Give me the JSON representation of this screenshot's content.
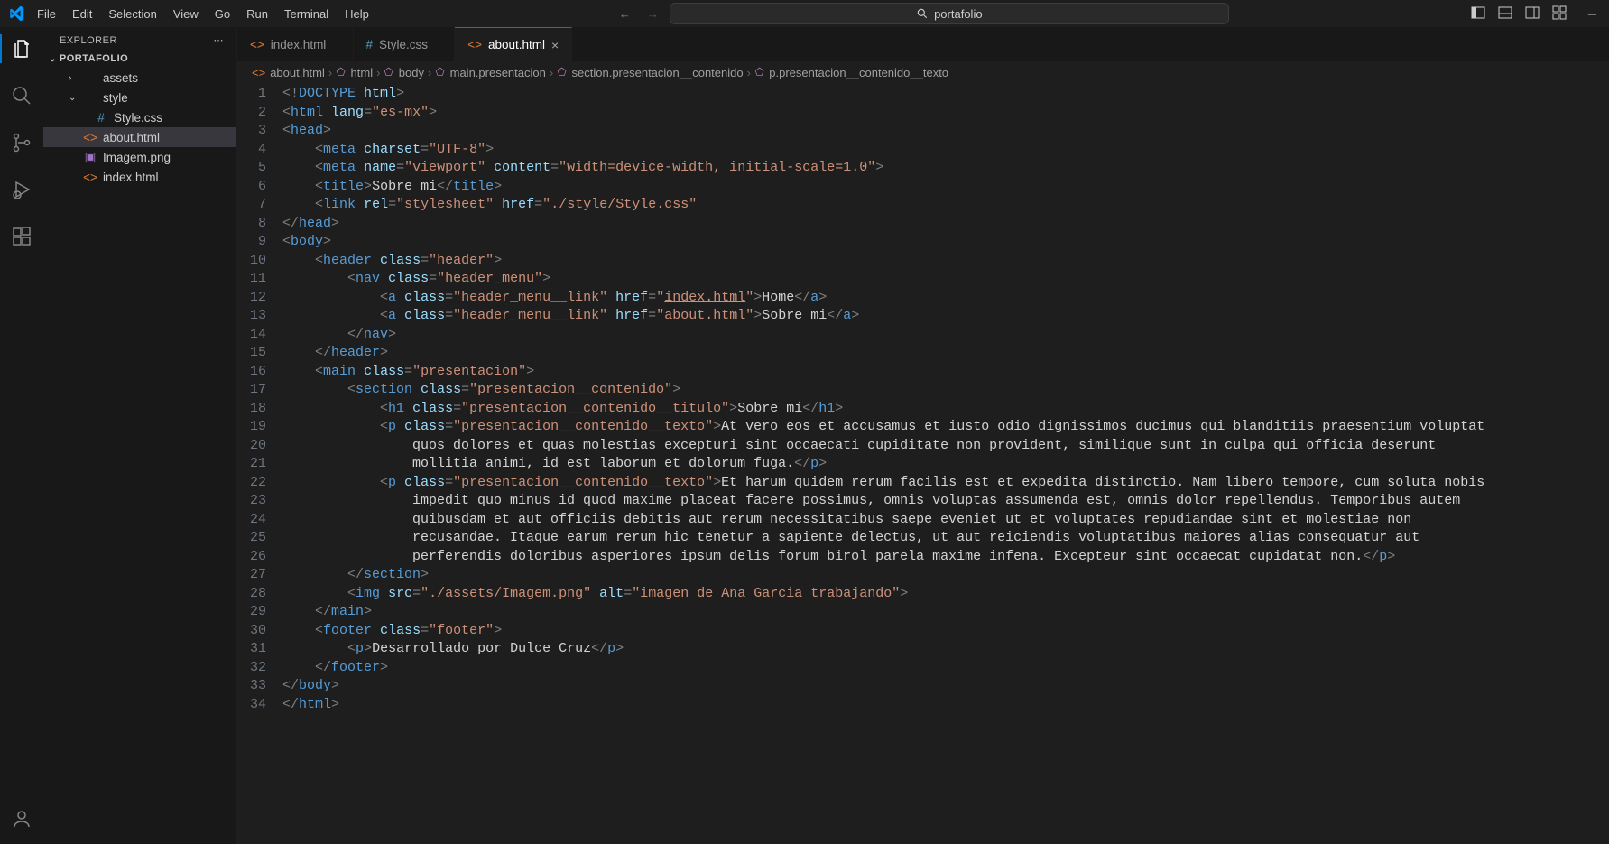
{
  "menubar": [
    "File",
    "Edit",
    "Selection",
    "View",
    "Go",
    "Run",
    "Terminal",
    "Help"
  ],
  "search": {
    "placeholder": "portafolio"
  },
  "sidebar": {
    "title": "EXPLORER",
    "project": "PORTAFOLIO",
    "tree": [
      {
        "type": "folder",
        "name": "assets",
        "expanded": false,
        "indent": 1
      },
      {
        "type": "folder",
        "name": "style",
        "expanded": true,
        "indent": 1
      },
      {
        "type": "file",
        "name": "Style.css",
        "icon": "css",
        "indent": 2
      },
      {
        "type": "file",
        "name": "about.html",
        "icon": "html",
        "indent": 1,
        "active": true
      },
      {
        "type": "file",
        "name": "Imagem.png",
        "icon": "img",
        "indent": 1
      },
      {
        "type": "file",
        "name": "index.html",
        "icon": "html",
        "indent": 1
      }
    ]
  },
  "tabs": [
    {
      "label": "index.html",
      "icon": "html",
      "active": false
    },
    {
      "label": "Style.css",
      "icon": "css",
      "active": false
    },
    {
      "label": "about.html",
      "icon": "html",
      "active": true
    }
  ],
  "breadcrumb": [
    {
      "icon": "file-html",
      "label": "about.html"
    },
    {
      "icon": "tag",
      "label": "html"
    },
    {
      "icon": "tag",
      "label": "body"
    },
    {
      "icon": "tag",
      "label": "main.presentacion"
    },
    {
      "icon": "tag",
      "label": "section.presentacion__contenido"
    },
    {
      "icon": "tag",
      "label": "p.presentacion__contenido__texto"
    }
  ],
  "code_lines": [
    {
      "n": 1,
      "html": "<span class='c-punct'>&lt;!</span><span class='c-doctype'>DOCTYPE</span> <span class='c-attr'>html</span><span class='c-punct'>&gt;</span>"
    },
    {
      "n": 2,
      "html": "<span class='c-punct'>&lt;</span><span class='c-tag'>html</span> <span class='c-attr'>lang</span><span class='c-punct'>=</span><span class='c-str'>\"es-mx\"</span><span class='c-punct'>&gt;</span>"
    },
    {
      "n": 3,
      "html": "<span class='c-punct'>&lt;</span><span class='c-tag'>head</span><span class='c-punct'>&gt;</span>"
    },
    {
      "n": 4,
      "html": "    <span class='c-punct'>&lt;</span><span class='c-tag'>meta</span> <span class='c-attr'>charset</span><span class='c-punct'>=</span><span class='c-str'>\"UTF-8\"</span><span class='c-punct'>&gt;</span>"
    },
    {
      "n": 5,
      "html": "    <span class='c-punct'>&lt;</span><span class='c-tag'>meta</span> <span class='c-attr'>name</span><span class='c-punct'>=</span><span class='c-str'>\"viewport\"</span> <span class='c-attr'>content</span><span class='c-punct'>=</span><span class='c-str'>\"width=device-width, initial-scale=1.0\"</span><span class='c-punct'>&gt;</span>"
    },
    {
      "n": 6,
      "html": "    <span class='c-punct'>&lt;</span><span class='c-tag'>title</span><span class='c-punct'>&gt;</span><span class='c-text'>Sobre mi</span><span class='c-punct'>&lt;/</span><span class='c-tag'>title</span><span class='c-punct'>&gt;</span>"
    },
    {
      "n": 7,
      "html": "    <span class='c-punct'>&lt;</span><span class='c-tag'>link</span> <span class='c-attr'>rel</span><span class='c-punct'>=</span><span class='c-str'>\"stylesheet\"</span> <span class='c-attr'>href</span><span class='c-punct'>=</span><span class='c-str'>\"</span><span class='c-str-u'>./style/Style.css</span><span class='c-str'>\"</span>"
    },
    {
      "n": 8,
      "html": "<span class='c-punct'>&lt;/</span><span class='c-tag'>head</span><span class='c-punct'>&gt;</span>"
    },
    {
      "n": 9,
      "html": "<span class='c-punct'>&lt;</span><span class='c-tag'>body</span><span class='c-punct'>&gt;</span>"
    },
    {
      "n": 10,
      "html": "    <span class='c-punct'>&lt;</span><span class='c-tag'>header</span> <span class='c-attr'>class</span><span class='c-punct'>=</span><span class='c-str'>\"header\"</span><span class='c-punct'>&gt;</span>"
    },
    {
      "n": 11,
      "html": "        <span class='c-punct'>&lt;</span><span class='c-tag'>nav</span> <span class='c-attr'>class</span><span class='c-punct'>=</span><span class='c-str'>\"header_menu\"</span><span class='c-punct'>&gt;</span>"
    },
    {
      "n": 12,
      "html": "            <span class='c-punct'>&lt;</span><span class='c-tag'>a</span> <span class='c-attr'>class</span><span class='c-punct'>=</span><span class='c-str'>\"header_menu__link\"</span> <span class='c-attr'>href</span><span class='c-punct'>=</span><span class='c-str'>\"</span><span class='c-str-u'>index.html</span><span class='c-str'>\"</span><span class='c-punct'>&gt;</span><span class='c-text'>Home</span><span class='c-punct'>&lt;/</span><span class='c-tag'>a</span><span class='c-punct'>&gt;</span>"
    },
    {
      "n": 13,
      "html": "            <span class='c-punct'>&lt;</span><span class='c-tag'>a</span> <span class='c-attr'>class</span><span class='c-punct'>=</span><span class='c-str'>\"header_menu__link\"</span> <span class='c-attr'>href</span><span class='c-punct'>=</span><span class='c-str'>\"</span><span class='c-str-u'>about.html</span><span class='c-str'>\"</span><span class='c-punct'>&gt;</span><span class='c-text'>Sobre mi</span><span class='c-punct'>&lt;/</span><span class='c-tag'>a</span><span class='c-punct'>&gt;</span>"
    },
    {
      "n": 14,
      "html": "        <span class='c-punct'>&lt;/</span><span class='c-tag'>nav</span><span class='c-punct'>&gt;</span>"
    },
    {
      "n": 15,
      "html": "    <span class='c-punct'>&lt;/</span><span class='c-tag'>header</span><span class='c-punct'>&gt;</span>"
    },
    {
      "n": 16,
      "html": "    <span class='c-punct'>&lt;</span><span class='c-tag'>main</span> <span class='c-attr'>class</span><span class='c-punct'>=</span><span class='c-str'>\"presentacion\"</span><span class='c-punct'>&gt;</span>"
    },
    {
      "n": 17,
      "html": "        <span class='c-punct'>&lt;</span><span class='c-tag'>section</span> <span class='c-attr'>class</span><span class='c-punct'>=</span><span class='c-str'>\"presentacion__contenido\"</span><span class='c-punct'>&gt;</span>"
    },
    {
      "n": 18,
      "html": "            <span class='c-punct'>&lt;</span><span class='c-tag'>h1</span> <span class='c-attr'>class</span><span class='c-punct'>=</span><span class='c-str'>\"presentacion__contenido__titulo\"</span><span class='c-punct'>&gt;</span><span class='c-text'>Sobre mí</span><span class='c-punct'>&lt;/</span><span class='c-tag'>h1</span><span class='c-punct'>&gt;</span>"
    },
    {
      "n": 19,
      "html": "            <span class='c-punct'>&lt;</span><span class='c-tag'>p</span> <span class='c-attr'>class</span><span class='c-punct'>=</span><span class='c-str'>\"presentacion__contenido__texto\"</span><span class='c-punct'>&gt;</span><span class='c-text'>At vero eos et accusamus et iusto odio dignissimos ducimus qui blanditiis praesentium voluptat</span>"
    },
    {
      "n": 20,
      "html": "                <span class='c-text'>quos dolores et quas molestias excepturi sint occaecati cupiditate non provident, similique sunt in culpa qui officia deserunt </span>"
    },
    {
      "n": 21,
      "html": "                <span class='c-text'>mollitia animi, id est laborum et dolorum fuga.</span><span class='c-punct'>&lt;/</span><span class='c-tag'>p</span><span class='c-punct'>&gt;</span>"
    },
    {
      "n": 22,
      "html": "            <span class='c-punct'>&lt;</span><span class='c-tag'>p</span> <span class='c-attr'>class</span><span class='c-punct'>=</span><span class='c-str'>\"presentacion__contenido__texto\"</span><span class='c-punct'>&gt;</span><span class='c-text'>Et harum quidem rerum facilis est et expedita distinctio. Nam libero tempore, cum soluta nobis</span>"
    },
    {
      "n": 23,
      "html": "                <span class='c-text'>impedit quo minus id quod maxime placeat facere possimus, omnis voluptas assumenda est, omnis dolor repellendus. Temporibus autem </span>"
    },
    {
      "n": 24,
      "html": "                <span class='c-text'>quibusdam et aut officiis debitis aut rerum necessitatibus saepe eveniet ut et voluptates repudiandae sint et molestiae non </span>"
    },
    {
      "n": 25,
      "html": "                <span class='c-text'>recusandae. Itaque earum rerum hic tenetur a sapiente delectus, ut aut reiciendis voluptatibus maiores alias consequatur aut </span>"
    },
    {
      "n": 26,
      "html": "                <span class='c-text'>perferendis doloribus asperiores ipsum delis forum birol parela maxime infena. Excepteur sint occaecat cupidatat non.</span><span class='c-punct'>&lt;/</span><span class='c-tag'>p</span><span class='c-punct'>&gt;</span>"
    },
    {
      "n": 27,
      "html": "        <span class='c-punct'>&lt;/</span><span class='c-tag'>section</span><span class='c-punct'>&gt;</span>"
    },
    {
      "n": 28,
      "html": "        <span class='c-punct'>&lt;</span><span class='c-tag'>img</span> <span class='c-attr'>src</span><span class='c-punct'>=</span><span class='c-str'>\"</span><span class='c-str-u'>./assets/Imagem.png</span><span class='c-str'>\"</span> <span class='c-attr'>alt</span><span class='c-punct'>=</span><span class='c-str'>\"imagen de Ana Garcia trabajando\"</span><span class='c-punct'>&gt;</span>"
    },
    {
      "n": 29,
      "html": "    <span class='c-punct'>&lt;/</span><span class='c-tag'>main</span><span class='c-punct'>&gt;</span>"
    },
    {
      "n": 30,
      "html": "    <span class='c-punct'>&lt;</span><span class='c-tag'>footer</span> <span class='c-attr'>class</span><span class='c-punct'>=</span><span class='c-str'>\"footer\"</span><span class='c-punct'>&gt;</span>"
    },
    {
      "n": 31,
      "html": "        <span class='c-punct'>&lt;</span><span class='c-tag'>p</span><span class='c-punct'>&gt;</span><span class='c-text'>Desarrollado por Dulce Cruz</span><span class='c-punct'>&lt;/</span><span class='c-tag'>p</span><span class='c-punct'>&gt;</span>"
    },
    {
      "n": 32,
      "html": "    <span class='c-punct'>&lt;/</span><span class='c-tag'>footer</span><span class='c-punct'>&gt;</span>"
    },
    {
      "n": 33,
      "html": "<span class='c-punct'>&lt;/</span><span class='c-tag'>body</span><span class='c-punct'>&gt;</span>"
    },
    {
      "n": 34,
      "html": "<span class='c-punct'>&lt;/</span><span class='c-tag'>html</span><span class='c-punct'>&gt;</span>"
    }
  ]
}
